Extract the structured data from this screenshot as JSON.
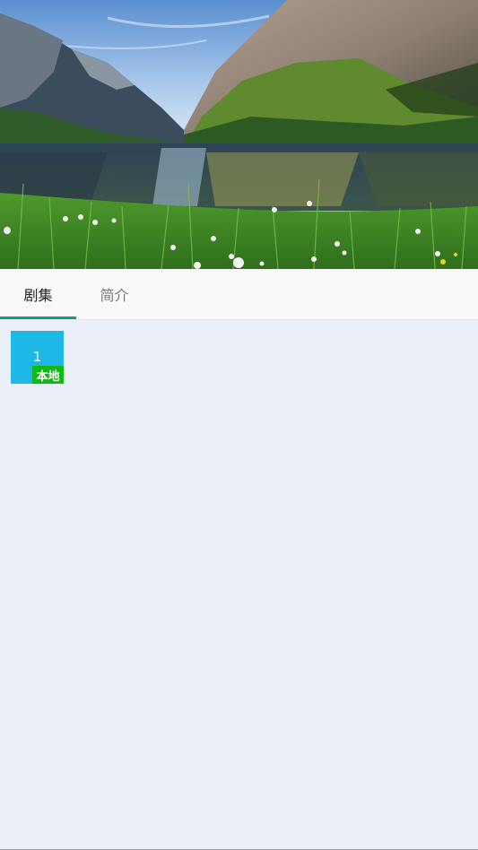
{
  "tabs": [
    {
      "label": "剧集",
      "active": true
    },
    {
      "label": "简介",
      "active": false
    }
  ],
  "episodes": [
    {
      "number": "1",
      "badge": "本地"
    }
  ],
  "colors": {
    "accent": "#159a86",
    "episode_tile": "#1eb8e6",
    "local_badge": "#14b814",
    "background": "#eaeff7"
  }
}
